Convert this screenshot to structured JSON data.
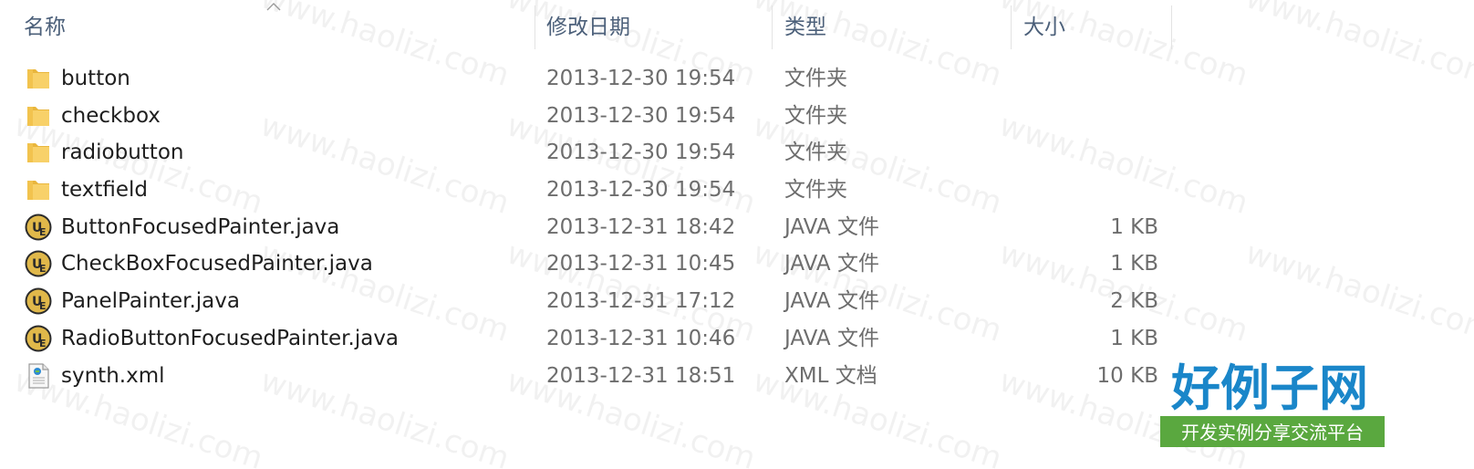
{
  "columns": {
    "name": "名称",
    "date": "修改日期",
    "type": "类型",
    "size": "大小"
  },
  "files": [
    {
      "name": "button",
      "date": "2013-12-30 19:54",
      "type": "文件夹",
      "size": "",
      "icon": "folder-icon"
    },
    {
      "name": "checkbox",
      "date": "2013-12-30 19:54",
      "type": "文件夹",
      "size": "",
      "icon": "folder-icon"
    },
    {
      "name": "radiobutton",
      "date": "2013-12-30 19:54",
      "type": "文件夹",
      "size": "",
      "icon": "folder-icon"
    },
    {
      "name": "textfield",
      "date": "2013-12-30 19:54",
      "type": "文件夹",
      "size": "",
      "icon": "folder-icon"
    },
    {
      "name": "ButtonFocusedPainter.java",
      "date": "2013-12-31 18:42",
      "type": "JAVA 文件",
      "size": "1 KB",
      "icon": "ue-java-file-icon"
    },
    {
      "name": "CheckBoxFocusedPainter.java",
      "date": "2013-12-31 10:45",
      "type": "JAVA 文件",
      "size": "1 KB",
      "icon": "ue-java-file-icon"
    },
    {
      "name": "PanelPainter.java",
      "date": "2013-12-31 17:12",
      "type": "JAVA 文件",
      "size": "2 KB",
      "icon": "ue-java-file-icon"
    },
    {
      "name": "RadioButtonFocusedPainter.java",
      "date": "2013-12-31 10:46",
      "type": "JAVA 文件",
      "size": "1 KB",
      "icon": "ue-java-file-icon"
    },
    {
      "name": "synth.xml",
      "date": "2013-12-31 18:51",
      "type": "XML 文档",
      "size": "10 KB",
      "icon": "xml-file-icon"
    }
  ],
  "watermark": {
    "text": "www.haolizi.com",
    "logo_title": "好例子网",
    "logo_subtitle": "开发实例分享交流平台"
  },
  "colors": {
    "header_text": "#4c607a",
    "name_text": "#1e1e1e",
    "detail_text": "#6d6d6d",
    "folder": "#f5c94e",
    "ue_icon": "#c8a23a",
    "logo_blue": "#1a86c9",
    "logo_green": "#5aa83f"
  }
}
